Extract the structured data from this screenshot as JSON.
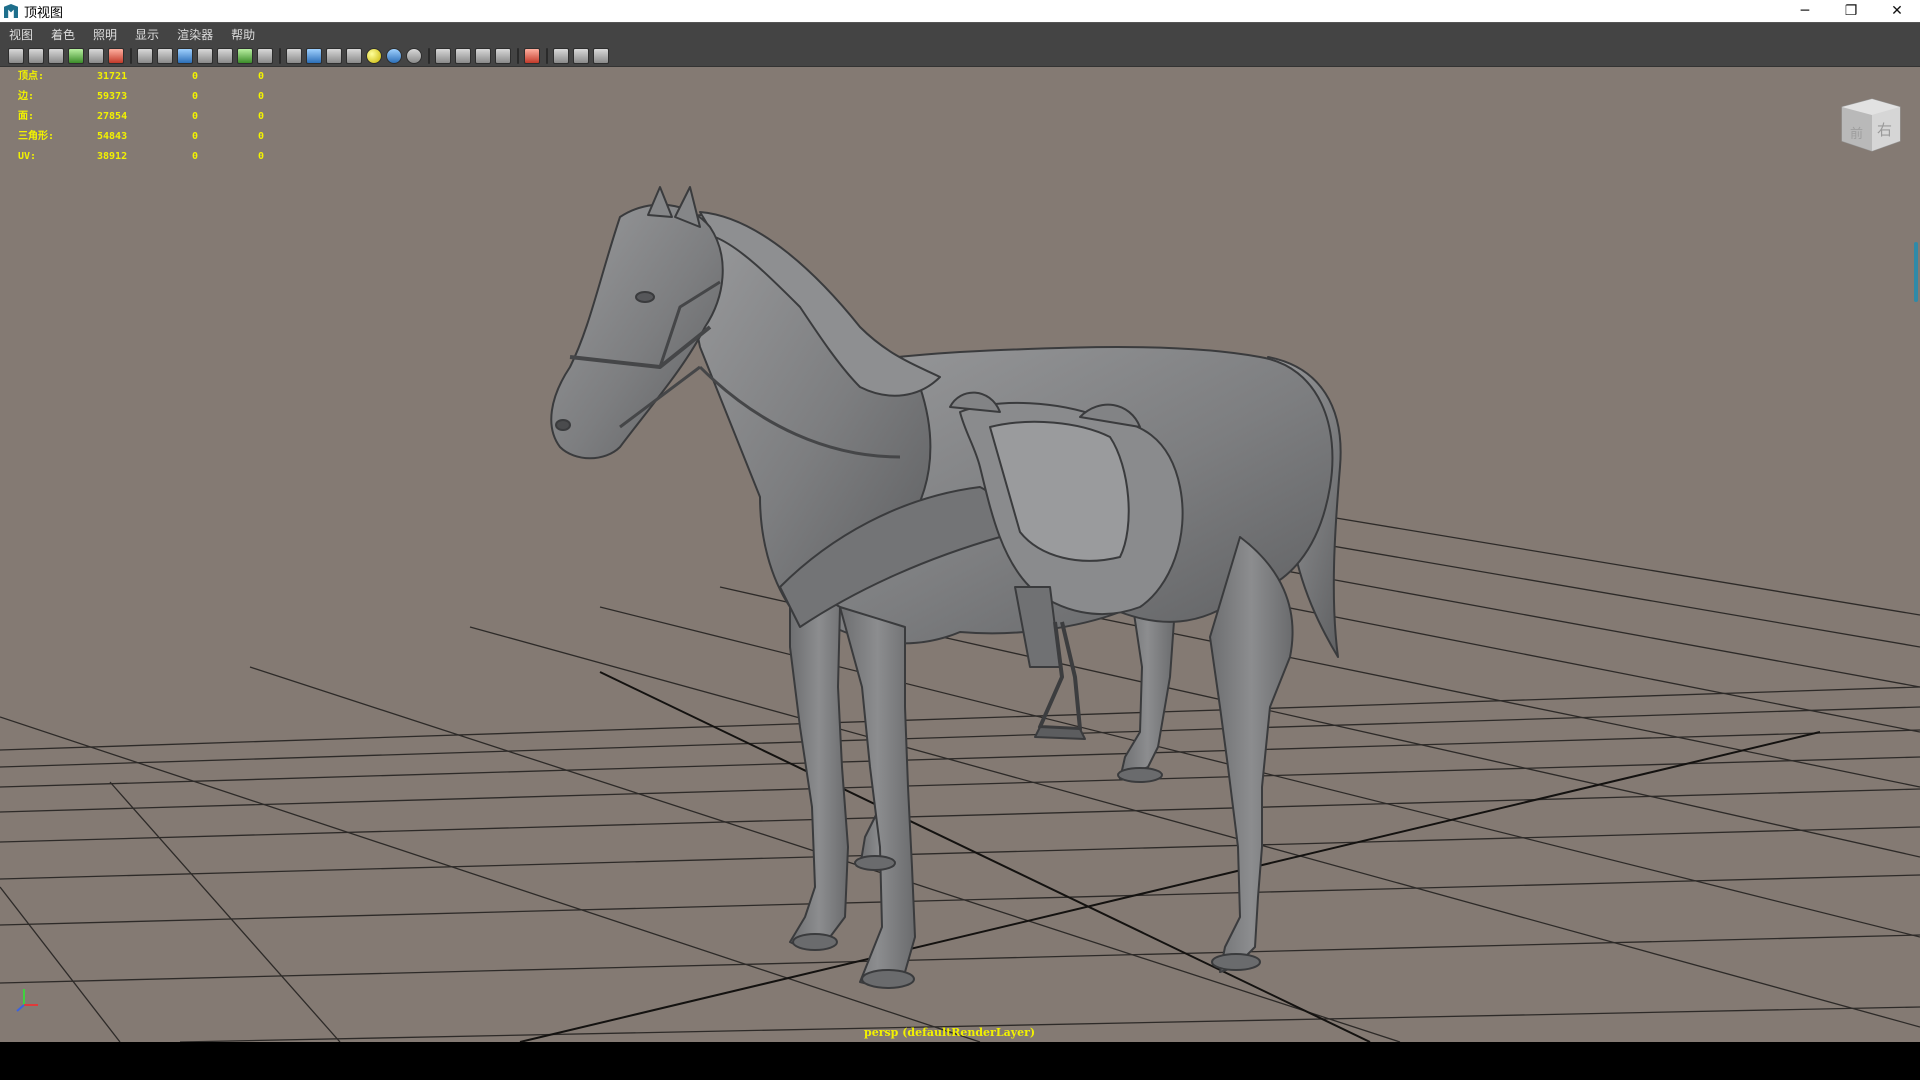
{
  "window": {
    "title": "顶视图",
    "buttons": {
      "minimize": "─",
      "restore": "❐",
      "close": "✕"
    }
  },
  "menu": [
    "视图",
    "着色",
    "照明",
    "显示",
    "渲染器",
    "帮助"
  ],
  "toolbar": {
    "icons": [
      "camera-icon",
      "camera-attr-icon",
      "bookmark-icon",
      "image-plane-icon",
      "grid-icon",
      "film-gate-icon",
      "resolution-gate-icon",
      "wireframe-icon",
      "smooth-shade-icon",
      "default-material-icon",
      "shade-all-icon",
      "texture-icon",
      "use-all-lights-icon",
      "shadows-icon",
      "isolate-icon",
      "xray-icon",
      "xray-joints-icon",
      "backface-icon",
      "hud-icon",
      "single-view-icon",
      "layout-icon",
      "share-icon"
    ]
  },
  "hud": {
    "rows": [
      {
        "label": "顶点:",
        "value": "31721",
        "sel1": "0",
        "sel2": "0"
      },
      {
        "label": "边:",
        "value": "59373",
        "sel1": "0",
        "sel2": "0"
      },
      {
        "label": "面:",
        "value": "27854",
        "sel1": "0",
        "sel2": "0"
      },
      {
        "label": "三角形:",
        "value": "54843",
        "sel1": "0",
        "sel2": "0"
      },
      {
        "label": "UV:",
        "value": "38912",
        "sel1": "0",
        "sel2": "0"
      }
    ]
  },
  "viewcube": {
    "left_face": "前",
    "right_face": "右"
  },
  "camera_label": "persp (defaultRenderLayer)",
  "colors": {
    "viewport_bg": "#847a73",
    "hud_text": "#f2f200",
    "grid_line": "#2d2a28",
    "model_gray": "#7f8082"
  }
}
